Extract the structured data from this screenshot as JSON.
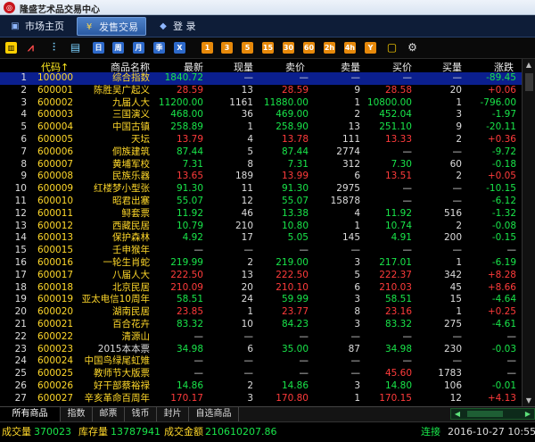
{
  "window": {
    "title": "隆盛艺术品交易中心",
    "logo_icon": "app-logo-icon"
  },
  "nav": {
    "items": [
      {
        "label": "市场主页",
        "icon": "home-icon"
      },
      {
        "label": "发售交易",
        "icon": "yen-icon"
      },
      {
        "label": "登  录",
        "icon": "login-icon"
      }
    ],
    "active_index": 1
  },
  "toolbar": {
    "icons": [
      "quote-board-icon",
      "kline-chart-icon",
      "multi-chart-icon",
      "report-icon"
    ],
    "period_buttons": [
      "日",
      "周",
      "月",
      "季",
      "X"
    ],
    "minute_buttons": [
      "1",
      "3",
      "5",
      "15",
      "30",
      "60",
      "2h",
      "4h",
      "Y"
    ],
    "settings_icon": "gear-icon"
  },
  "colors": {
    "up": "#ff3b3b",
    "down": "#19e64a",
    "flat": "#dddddd",
    "code": "#ffd82a",
    "selected_row": "#0b1f8e",
    "nav_bg": "#0e1d38"
  },
  "columns": [
    "代码↑",
    "商品名称",
    "最新",
    "现量",
    "卖价",
    "卖量",
    "买价",
    "买量",
    "涨跌"
  ],
  "rows": [
    {
      "n": "1",
      "code": "100000",
      "name": "综合指数",
      "last": "1840.72",
      "vol": "—",
      "ask": "—",
      "askv": "—",
      "bid": "—",
      "bidv": "—",
      "chg": "-89.45",
      "dir": "down",
      "nc": "y"
    },
    {
      "n": "2",
      "code": "600001",
      "name": "陈胜吴广起义",
      "last": "28.59",
      "vol": "13",
      "ask": "28.59",
      "askv": "9",
      "bid": "28.58",
      "bidv": "20",
      "chg": "+0.06",
      "dir": "up",
      "nc": "y"
    },
    {
      "n": "3",
      "code": "600002",
      "name": "九届人大",
      "last": "11200.00",
      "vol": "1161",
      "ask": "11880.00",
      "askv": "1",
      "bid": "10800.00",
      "bidv": "1",
      "chg": "-796.00",
      "dir": "down",
      "nc": "y"
    },
    {
      "n": "4",
      "code": "600003",
      "name": "三国演义",
      "last": "468.00",
      "vol": "36",
      "ask": "469.00",
      "askv": "2",
      "bid": "452.04",
      "bidv": "3",
      "chg": "-1.97",
      "dir": "down",
      "nc": "y"
    },
    {
      "n": "5",
      "code": "600004",
      "name": "中国古镇",
      "last": "258.89",
      "vol": "1",
      "ask": "258.90",
      "askv": "13",
      "bid": "251.10",
      "bidv": "9",
      "chg": "-20.11",
      "dir": "down",
      "nc": "y"
    },
    {
      "n": "6",
      "code": "600005",
      "name": "天坛",
      "last": "13.79",
      "vol": "4",
      "ask": "13.78",
      "askv": "111",
      "bid": "13.33",
      "bidv": "2",
      "chg": "+0.36",
      "dir": "up",
      "nc": "y"
    },
    {
      "n": "7",
      "code": "600006",
      "name": "侗族建筑",
      "last": "87.44",
      "vol": "5",
      "ask": "87.44",
      "askv": "2774",
      "bid": "—",
      "bidv": "—",
      "chg": "-9.72",
      "dir": "down",
      "nc": "y"
    },
    {
      "n": "8",
      "code": "600007",
      "name": "黄埔军校",
      "last": "7.31",
      "vol": "8",
      "ask": "7.31",
      "askv": "312",
      "bid": "7.30",
      "bidv": "60",
      "chg": "-0.18",
      "dir": "down",
      "nc": "y"
    },
    {
      "n": "9",
      "code": "600008",
      "name": "民族乐器",
      "last": "13.65",
      "vol": "189",
      "ask": "13.99",
      "askv": "6",
      "bid": "13.51",
      "bidv": "2",
      "chg": "+0.05",
      "dir": "up",
      "nc": "y"
    },
    {
      "n": "10",
      "code": "600009",
      "name": "红楼梦小型张",
      "last": "91.30",
      "vol": "11",
      "ask": "91.30",
      "askv": "2975",
      "bid": "—",
      "bidv": "—",
      "chg": "-10.15",
      "dir": "down",
      "nc": "y"
    },
    {
      "n": "11",
      "code": "600010",
      "name": "昭君出塞",
      "last": "55.07",
      "vol": "12",
      "ask": "55.07",
      "askv": "15878",
      "bid": "—",
      "bidv": "—",
      "chg": "-6.12",
      "dir": "down",
      "nc": "y"
    },
    {
      "n": "12",
      "code": "600011",
      "name": "鲟套票",
      "last": "11.92",
      "vol": "46",
      "ask": "13.38",
      "askv": "4",
      "bid": "11.92",
      "bidv": "516",
      "chg": "-1.32",
      "dir": "down",
      "nc": "y"
    },
    {
      "n": "13",
      "code": "600012",
      "name": "西藏民居",
      "last": "10.79",
      "vol": "210",
      "ask": "10.80",
      "askv": "1",
      "bid": "10.74",
      "bidv": "2",
      "chg": "-0.08",
      "dir": "down",
      "nc": "y"
    },
    {
      "n": "14",
      "code": "600013",
      "name": "保护森林",
      "last": "4.92",
      "vol": "17",
      "ask": "5.05",
      "askv": "145",
      "bid": "4.91",
      "bidv": "200",
      "chg": "-0.15",
      "dir": "down",
      "nc": "y"
    },
    {
      "n": "15",
      "code": "600015",
      "name": "壬申猴年",
      "last": "—",
      "vol": "—",
      "ask": "—",
      "askv": "—",
      "bid": "—",
      "bidv": "—",
      "chg": "—",
      "dir": "flat",
      "nc": "y"
    },
    {
      "n": "16",
      "code": "600016",
      "name": "一轮生肖蛇",
      "last": "219.99",
      "vol": "2",
      "ask": "219.00",
      "askv": "3",
      "bid": "217.01",
      "bidv": "1",
      "chg": "-6.19",
      "dir": "down",
      "nc": "y"
    },
    {
      "n": "17",
      "code": "600017",
      "name": "八届人大",
      "last": "222.50",
      "vol": "13",
      "ask": "222.50",
      "askv": "5",
      "bid": "222.37",
      "bidv": "342",
      "chg": "+8.28",
      "dir": "up",
      "nc": "y"
    },
    {
      "n": "18",
      "code": "600018",
      "name": "北京民居",
      "last": "210.09",
      "vol": "20",
      "ask": "210.10",
      "askv": "6",
      "bid": "210.03",
      "bidv": "45",
      "chg": "+8.66",
      "dir": "up",
      "nc": "y"
    },
    {
      "n": "19",
      "code": "600019",
      "name": "亚太电信10周年",
      "last": "58.51",
      "vol": "24",
      "ask": "59.99",
      "askv": "3",
      "bid": "58.51",
      "bidv": "15",
      "chg": "-4.64",
      "dir": "down",
      "nc": "y"
    },
    {
      "n": "20",
      "code": "600020",
      "name": "湖南民居",
      "last": "23.85",
      "vol": "1",
      "ask": "23.77",
      "askv": "8",
      "bid": "23.16",
      "bidv": "1",
      "chg": "+0.25",
      "dir": "up",
      "nc": "y"
    },
    {
      "n": "21",
      "code": "600021",
      "name": "百合花卉",
      "last": "83.32",
      "vol": "10",
      "ask": "84.23",
      "askv": "3",
      "bid": "83.32",
      "bidv": "275",
      "chg": "-4.61",
      "dir": "down",
      "nc": "y"
    },
    {
      "n": "22",
      "code": "600022",
      "name": "清源山",
      "last": "—",
      "vol": "—",
      "ask": "—",
      "askv": "—",
      "bid": "—",
      "bidv": "—",
      "chg": "—",
      "dir": "flat",
      "nc": "y"
    },
    {
      "n": "23",
      "code": "600023",
      "name": "2015本本票",
      "last": "34.98",
      "vol": "6",
      "ask": "35.00",
      "askv": "87",
      "bid": "34.98",
      "bidv": "230",
      "chg": "-0.03",
      "dir": "down",
      "nc": "w"
    },
    {
      "n": "24",
      "code": "600024",
      "name": "中国鸟绿尾虹雉",
      "last": "—",
      "vol": "—",
      "ask": "—",
      "askv": "—",
      "bid": "—",
      "bidv": "—",
      "chg": "—",
      "dir": "flat",
      "nc": "y"
    },
    {
      "n": "25",
      "code": "600025",
      "name": "教师节大版票",
      "last": "—",
      "vol": "—",
      "ask": "—",
      "askv": "—",
      "bid": "45.60",
      "bidv": "1783",
      "chg": "—",
      "dir": "flat",
      "nc": "y",
      "bidred": true
    },
    {
      "n": "26",
      "code": "600026",
      "name": "好干部蔡裕禄",
      "last": "14.86",
      "vol": "2",
      "ask": "14.86",
      "askv": "3",
      "bid": "14.80",
      "bidv": "106",
      "chg": "-0.01",
      "dir": "down",
      "nc": "y"
    },
    {
      "n": "27",
      "code": "600027",
      "name": "辛亥革命百周年",
      "last": "170.17",
      "vol": "3",
      "ask": "170.80",
      "askv": "1",
      "bid": "170.15",
      "bidv": "12",
      "chg": "+4.13",
      "dir": "up",
      "nc": "y"
    }
  ],
  "tabs": [
    "所有商品",
    "指数",
    "邮票",
    "钱币",
    "封片",
    "自选商品"
  ],
  "tabs_active": 0,
  "status": {
    "vol_label": "成交量",
    "vol_value": "370023",
    "inv_label": "库存量",
    "inv_value": "13787941",
    "amt_label": "成交金额",
    "amt_value": "210610207.86",
    "conn": "连接",
    "datetime": "2016-10-27  10:55"
  }
}
